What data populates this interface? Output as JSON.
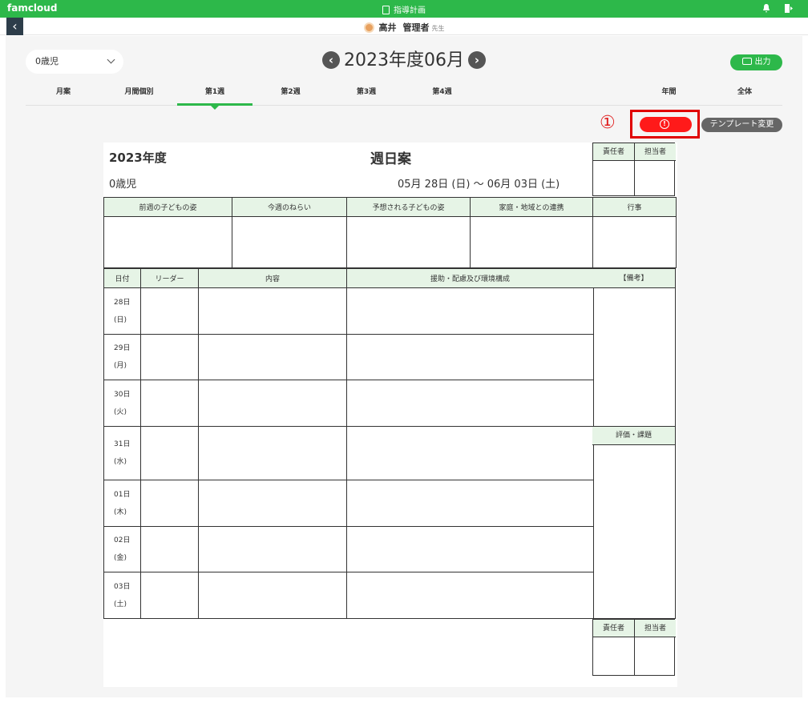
{
  "topbar": {
    "logo": "famcloud",
    "title": "指導計画",
    "bell_icon": "bell-icon",
    "logout_icon": "logout-icon"
  },
  "userbar": {
    "back_icon": "chevron-left-icon",
    "name": "高井",
    "role": "管理者",
    "honorific": "先生"
  },
  "header": {
    "age_select": "0歳児",
    "month": "2023年度06月",
    "prev_icon": "chevron-left-circle-icon",
    "next_icon": "chevron-right-circle-icon",
    "output_label": "出力"
  },
  "tabs": [
    {
      "label": "月案"
    },
    {
      "label": "月間個別"
    },
    {
      "label": "第1週",
      "active": true
    },
    {
      "label": "第2週"
    },
    {
      "label": "第3週"
    },
    {
      "label": "第4週"
    },
    {
      "label": "年間"
    },
    {
      "label": "全体"
    }
  ],
  "annotation": {
    "marker": "①"
  },
  "actions": {
    "alert_icon": "exclamation-icon",
    "template_label": "テンプレート変更"
  },
  "doc": {
    "year": "2023年度",
    "title": "週日案",
    "class": "0歳児",
    "date_range": "05月 28日 (日) ～ 06月 03日 (土)",
    "sign_headers": [
      "責任者",
      "担当者"
    ],
    "top_headers": [
      "前週の子どもの姿",
      "今週のねらい",
      "予想される子どもの姿",
      "家庭・地域との連携",
      "行事"
    ],
    "day_headers": [
      "日付",
      "リーダー",
      "内容",
      "援助・配慮及び環境構成"
    ],
    "note_header": "【備考】",
    "eval_header": "評価・課題",
    "days": [
      {
        "date": "28日",
        "dow": "(日)"
      },
      {
        "date": "29日",
        "dow": "(月)"
      },
      {
        "date": "30日",
        "dow": "(火)"
      },
      {
        "date": "31日",
        "dow": "(水)"
      },
      {
        "date": "01日",
        "dow": "(木)"
      },
      {
        "date": "02日",
        "dow": "(金)"
      },
      {
        "date": "03日",
        "dow": "(土)"
      }
    ]
  }
}
